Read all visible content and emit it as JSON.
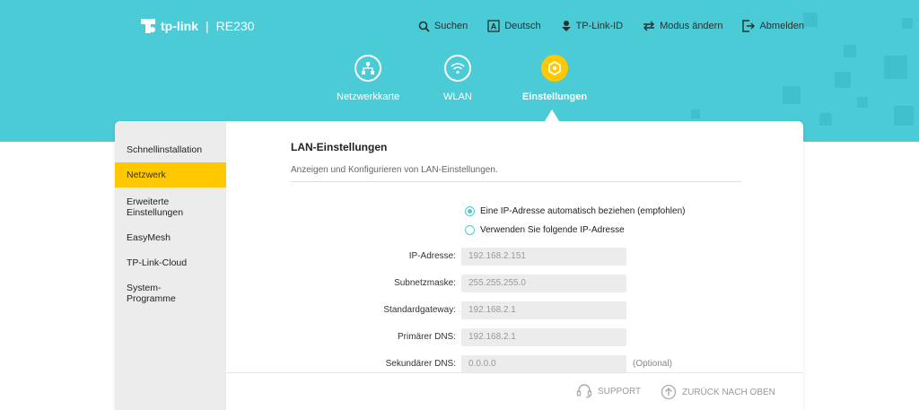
{
  "brand": {
    "logo_text": "tp-link",
    "separator": "|",
    "model": "RE230"
  },
  "topnav": [
    {
      "label": "Suchen",
      "icon": "search-icon"
    },
    {
      "label": "Deutsch",
      "icon": "language-icon"
    },
    {
      "label": "TP-Link-ID",
      "icon": "tplink-id-icon"
    },
    {
      "label": "Modus ändern",
      "icon": "mode-switch-icon"
    },
    {
      "label": "Abmelden",
      "icon": "logout-icon"
    }
  ],
  "mainnav": [
    {
      "label": "Netzwerkkarte",
      "icon": "network-map-icon",
      "active": false
    },
    {
      "label": "WLAN",
      "icon": "wifi-icon",
      "active": false
    },
    {
      "label": "Einstellungen",
      "icon": "settings-icon",
      "active": true
    }
  ],
  "sidebar": {
    "items": [
      {
        "label": "Schnellinstallation",
        "active": false
      },
      {
        "label": "Netzwerk",
        "active": true
      },
      {
        "label": "Erweiterte Einstellungen",
        "active": false
      },
      {
        "label": "EasyMesh",
        "active": false
      },
      {
        "label": "TP-Link-Cloud",
        "active": false
      },
      {
        "label": "System-Programme",
        "active": false
      }
    ]
  },
  "content": {
    "title": "LAN-Einstellungen",
    "description": "Anzeigen und Konfigurieren von LAN-Einstellungen.",
    "options": [
      {
        "label": "Eine IP-Adresse automatisch beziehen (empfohlen)",
        "checked": true
      },
      {
        "label": "Verwenden Sie folgende IP-Adresse",
        "checked": false
      }
    ],
    "fields": [
      {
        "label": "IP-Adresse:",
        "value": "192.168.2.151",
        "note": ""
      },
      {
        "label": "Subnetzmaske:",
        "value": "255.255.255.0",
        "note": ""
      },
      {
        "label": "Standardgateway:",
        "value": "192.168.2.1",
        "note": ""
      },
      {
        "label": "Primärer DNS:",
        "value": "192.168.2.1",
        "note": ""
      },
      {
        "label": "Sekundärer DNS:",
        "value": "0.0.0.0",
        "note": "(Optional)"
      }
    ]
  },
  "footer": {
    "support": "SUPPORT",
    "back_to_top": "ZURÜCK NACH OBEN"
  },
  "colors": {
    "header": "#4acbd6",
    "accent": "#ffc800",
    "sidebar": "#ececec"
  }
}
